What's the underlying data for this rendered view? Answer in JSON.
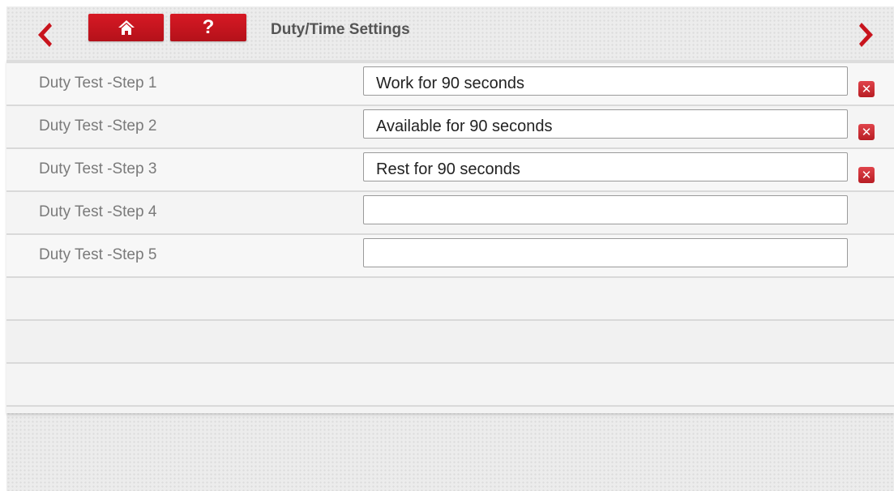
{
  "header": {
    "title": "Duty/Time Settings",
    "help_label": "?",
    "icons": {
      "back": "chevron-left-icon",
      "forward": "chevron-right-icon",
      "home": "home-icon"
    },
    "colors": {
      "accent": "#c8141d",
      "title": "#555555"
    }
  },
  "steps": [
    {
      "label": "Duty Test -Step 1",
      "value": "Work for 90 seconds"
    },
    {
      "label": "Duty Test -Step 2",
      "value": "Available for 90 seconds"
    },
    {
      "label": "Duty Test -Step 3",
      "value": "Rest for 90 seconds"
    },
    {
      "label": "Duty Test -Step 4",
      "value": ""
    },
    {
      "label": "Duty Test -Step 5",
      "value": ""
    }
  ],
  "delete_label": "✕"
}
